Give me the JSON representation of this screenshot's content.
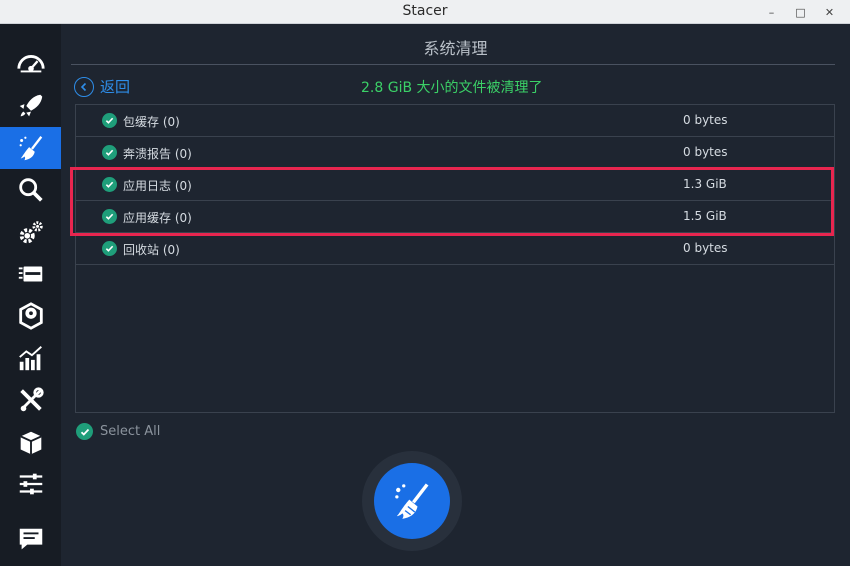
{
  "window": {
    "title": "Stacer",
    "controls": [
      "–",
      "□",
      "✕"
    ]
  },
  "sidebar": {
    "items": [
      {
        "name": "dashboard-icon",
        "active": false
      },
      {
        "name": "startup-apps-icon",
        "active": false
      },
      {
        "name": "system-cleaner-icon",
        "active": true
      },
      {
        "name": "search-icon",
        "active": false
      },
      {
        "name": "services-icon",
        "active": false
      },
      {
        "name": "processes-icon",
        "active": false
      },
      {
        "name": "uninstaller-icon",
        "active": false
      },
      {
        "name": "resources-icon",
        "active": false
      },
      {
        "name": "helpers-icon",
        "active": false
      },
      {
        "name": "apt-repository-icon",
        "active": false
      },
      {
        "name": "settings-icon",
        "active": false
      },
      {
        "name": "feedback-icon",
        "active": false
      }
    ]
  },
  "page": {
    "title": "系统清理",
    "back_label": "返回",
    "summary": "2.8 GiB 大小的文件被清理了"
  },
  "list": {
    "rows": [
      {
        "label": "包缓存 (0)",
        "size": "0 bytes"
      },
      {
        "label": "奔溃报告 (0)",
        "size": "0 bytes"
      },
      {
        "label": "应用日志 (0)",
        "size": "1.3 GiB"
      },
      {
        "label": "应用缓存 (0)",
        "size": "1.5 GiB"
      },
      {
        "label": "回收站 (0)",
        "size": "0 bytes"
      }
    ]
  },
  "select_all_label": "Select All",
  "colors": {
    "accent": "#1a6fe6",
    "success_text": "#3bd167",
    "check": "#1f9e7a",
    "highlight": "#e8264f",
    "background": "#1e2530",
    "sidebar": "#171c24"
  }
}
